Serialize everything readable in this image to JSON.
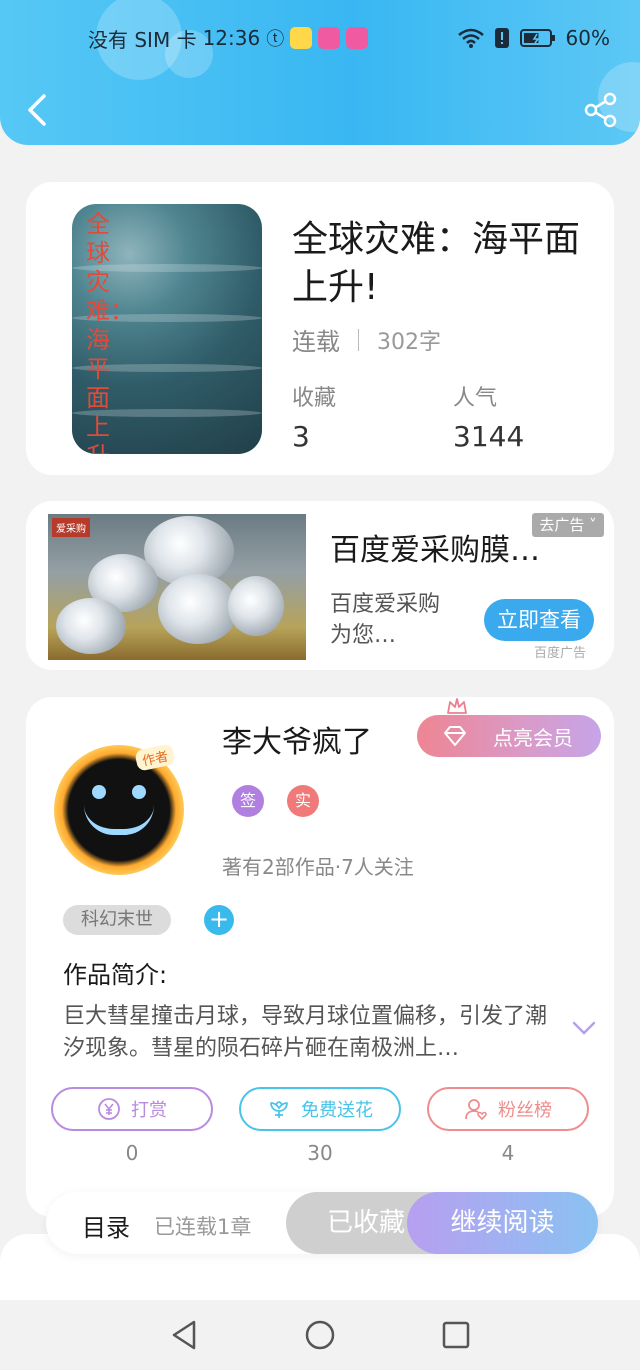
{
  "status_bar": {
    "carrier": "没有 SIM 卡",
    "time": "12:36",
    "battery": "60%",
    "battery_level": 0.6
  },
  "header": {
    "back_icon": "back-arrow-icon",
    "share_icon": "share-icon"
  },
  "book": {
    "cover_title": "全球灾难：海平面上升",
    "title": "全球灾难：海平面上升!",
    "status": "连载",
    "word_count": "302字",
    "favorites_label": "收藏",
    "favorites_value": "3",
    "popularity_label": "人气",
    "popularity_value": "3144"
  },
  "ad": {
    "title": "百度爱采购膜…",
    "description": "百度爱采购为您…",
    "cta": "立即查看",
    "close_label": "去广告",
    "source": "百度广告",
    "logo_text": "爱采购"
  },
  "author": {
    "avatar_tag": "作者",
    "name": "李大爷疯了",
    "vip_label": "点亮会员",
    "badges": [
      {
        "label": "签",
        "color": "#b07fe0"
      },
      {
        "label": "实",
        "color": "#f07a7a"
      }
    ],
    "stats": "著有2部作品·7人关注",
    "genre": "科幻末世",
    "add_icon": "+",
    "intro_title": "作品简介:",
    "intro_text": "巨大彗星撞击月球，导致月球位置偏移，引发了潮汐现象。彗星的陨石碎片砸在南极洲上…",
    "actions": [
      {
        "label": "打赏",
        "count": "0",
        "color": "#b98be0",
        "icon": "yen-coin-icon"
      },
      {
        "label": "免费送花",
        "count": "30",
        "color": "#49c3e8",
        "icon": "flower-icon"
      },
      {
        "label": "粉丝榜",
        "count": "4",
        "color": "#ef8c8c",
        "icon": "fan-user-icon"
      }
    ]
  },
  "bottom_bar": {
    "toc_label": "目录",
    "chapters": "已连载1章",
    "favorited_label": "已收藏",
    "read_label": "继续阅读"
  },
  "nav": {
    "back": "nav-back-icon",
    "home": "nav-home-icon",
    "recents": "nav-recents-icon"
  },
  "colors": {
    "header": "#39b7f2",
    "accent": "#3ab9ec",
    "vip_gradient_start": "#ee8592",
    "read_gradient_start": "#b79ff0"
  }
}
